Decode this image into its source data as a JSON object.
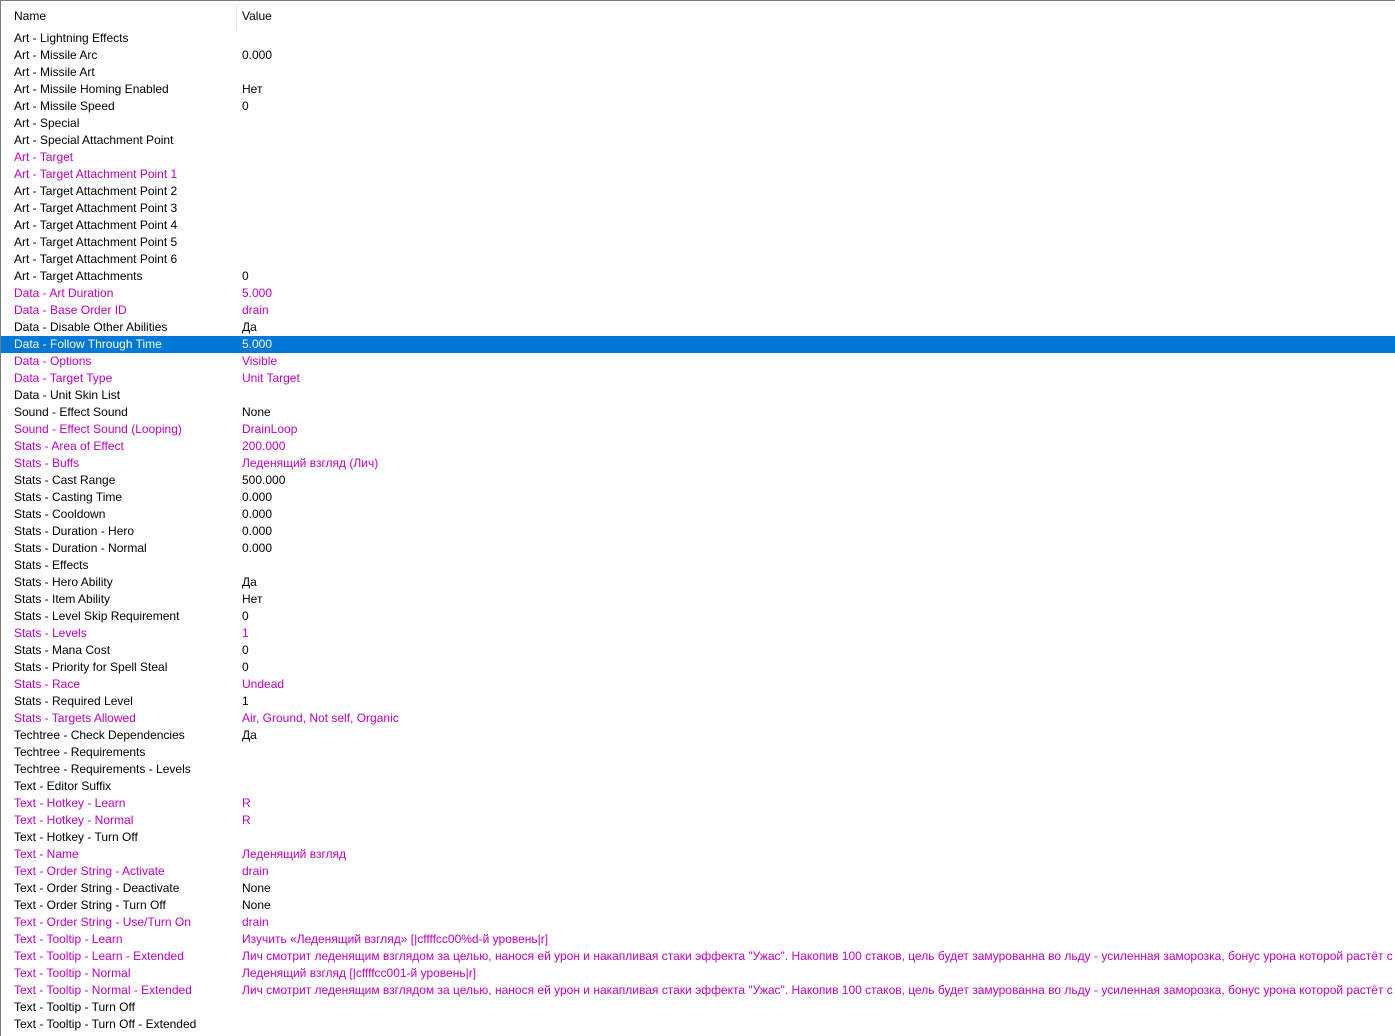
{
  "columns": {
    "name": "Name",
    "value": "Value"
  },
  "colors": {
    "modified": "#c000c0",
    "selection": "#0078d7"
  },
  "rows": [
    {
      "name": "Art - Lightning Effects",
      "value": "",
      "modified": false
    },
    {
      "name": "Art - Missile Arc",
      "value": "0.000",
      "modified": false
    },
    {
      "name": "Art - Missile Art",
      "value": "",
      "modified": false
    },
    {
      "name": "Art - Missile Homing Enabled",
      "value": "Нет",
      "modified": false
    },
    {
      "name": "Art - Missile Speed",
      "value": "0",
      "modified": false
    },
    {
      "name": "Art - Special",
      "value": "",
      "modified": false
    },
    {
      "name": "Art - Special Attachment Point",
      "value": "",
      "modified": false
    },
    {
      "name": "Art - Target",
      "value": "",
      "modified": true
    },
    {
      "name": "Art - Target Attachment Point 1",
      "value": "",
      "modified": true
    },
    {
      "name": "Art - Target Attachment Point 2",
      "value": "",
      "modified": false
    },
    {
      "name": "Art - Target Attachment Point 3",
      "value": "",
      "modified": false
    },
    {
      "name": "Art - Target Attachment Point 4",
      "value": "",
      "modified": false
    },
    {
      "name": "Art - Target Attachment Point 5",
      "value": "",
      "modified": false
    },
    {
      "name": "Art - Target Attachment Point 6",
      "value": "",
      "modified": false
    },
    {
      "name": "Art - Target Attachments",
      "value": "0",
      "modified": false
    },
    {
      "name": "Data - Art Duration",
      "value": "5.000",
      "modified": true
    },
    {
      "name": "Data - Base Order ID",
      "value": "drain",
      "modified": true
    },
    {
      "name": "Data - Disable Other Abilities",
      "value": "Да",
      "modified": false
    },
    {
      "name": "Data - Follow Through Time",
      "value": "5.000",
      "modified": true,
      "selected": true
    },
    {
      "name": "Data - Options",
      "value": "Visible",
      "modified": true
    },
    {
      "name": "Data - Target Type",
      "value": "Unit Target",
      "modified": true
    },
    {
      "name": "Data - Unit Skin List",
      "value": "",
      "modified": false
    },
    {
      "name": "Sound - Effect Sound",
      "value": "None",
      "modified": false
    },
    {
      "name": "Sound - Effect Sound (Looping)",
      "value": "DrainLoop",
      "modified": true
    },
    {
      "name": "Stats - Area of Effect",
      "value": "200.000",
      "modified": true
    },
    {
      "name": "Stats - Buffs",
      "value": "Леденящий взгляд (Лич)",
      "modified": true
    },
    {
      "name": "Stats - Cast Range",
      "value": "500.000",
      "modified": false
    },
    {
      "name": "Stats - Casting Time",
      "value": "0.000",
      "modified": false
    },
    {
      "name": "Stats - Cooldown",
      "value": "0.000",
      "modified": false
    },
    {
      "name": "Stats - Duration - Hero",
      "value": "0.000",
      "modified": false
    },
    {
      "name": "Stats - Duration - Normal",
      "value": "0.000",
      "modified": false
    },
    {
      "name": "Stats - Effects",
      "value": "",
      "modified": false
    },
    {
      "name": "Stats - Hero Ability",
      "value": "Да",
      "modified": false
    },
    {
      "name": "Stats - Item Ability",
      "value": "Нет",
      "modified": false
    },
    {
      "name": "Stats - Level Skip Requirement",
      "value": "0",
      "modified": false
    },
    {
      "name": "Stats - Levels",
      "value": "1",
      "modified": true
    },
    {
      "name": "Stats - Mana Cost",
      "value": "0",
      "modified": false
    },
    {
      "name": "Stats - Priority for Spell Steal",
      "value": "0",
      "modified": false
    },
    {
      "name": "Stats - Race",
      "value": "Undead",
      "modified": true
    },
    {
      "name": "Stats - Required Level",
      "value": "1",
      "modified": false
    },
    {
      "name": "Stats - Targets Allowed",
      "value": "Air, Ground, Not self, Organic",
      "modified": true
    },
    {
      "name": "Techtree - Check Dependencies",
      "value": "Да",
      "modified": false
    },
    {
      "name": "Techtree - Requirements",
      "value": "",
      "modified": false
    },
    {
      "name": "Techtree - Requirements - Levels",
      "value": "",
      "modified": false
    },
    {
      "name": "Text - Editor Suffix",
      "value": "",
      "modified": false
    },
    {
      "name": "Text - Hotkey - Learn",
      "value": "R",
      "modified": true
    },
    {
      "name": "Text - Hotkey - Normal",
      "value": "R",
      "modified": true
    },
    {
      "name": "Text - Hotkey - Turn Off",
      "value": "",
      "modified": false
    },
    {
      "name": "Text - Name",
      "value": "Леденящий взгляд",
      "modified": true
    },
    {
      "name": "Text - Order String - Activate",
      "value": "drain",
      "modified": true
    },
    {
      "name": "Text - Order String - Deactivate",
      "value": "None",
      "modified": false
    },
    {
      "name": "Text - Order String - Turn Off",
      "value": "None",
      "modified": false
    },
    {
      "name": "Text - Order String - Use/Turn On",
      "value": "drain",
      "modified": true
    },
    {
      "name": "Text - Tooltip - Learn",
      "value": "Изучить «Леденящий взгляд» [|cffffcc00%d-й уровень|r]",
      "modified": true
    },
    {
      "name": "Text - Tooltip - Learn - Extended",
      "value": "Лич смотрит леденящим взглядом за целью, нанося ей урон и накапливая стаки эффекта \"Ужас\". Накопив 100 стаков, цель будет замурованна во льду - усиленная заморозка, бонус урона которой растёт с количеством ста",
      "modified": true
    },
    {
      "name": "Text - Tooltip - Normal",
      "value": "Леденящий взгляд [|cffffcc001-й уровень|r]",
      "modified": true
    },
    {
      "name": "Text - Tooltip - Normal - Extended",
      "value": "Лич смотрит леденящим взглядом за целью, нанося ей урон и накапливая стаки эффекта \"Ужас\". Накопив 100 стаков, цель будет замурованна во льду - усиленная заморозка, бонус урона которой растёт с количеством ста",
      "modified": true
    },
    {
      "name": "Text - Tooltip - Turn Off",
      "value": "",
      "modified": false
    },
    {
      "name": "Text - Tooltip - Turn Off - Extended",
      "value": "",
      "modified": false
    }
  ]
}
